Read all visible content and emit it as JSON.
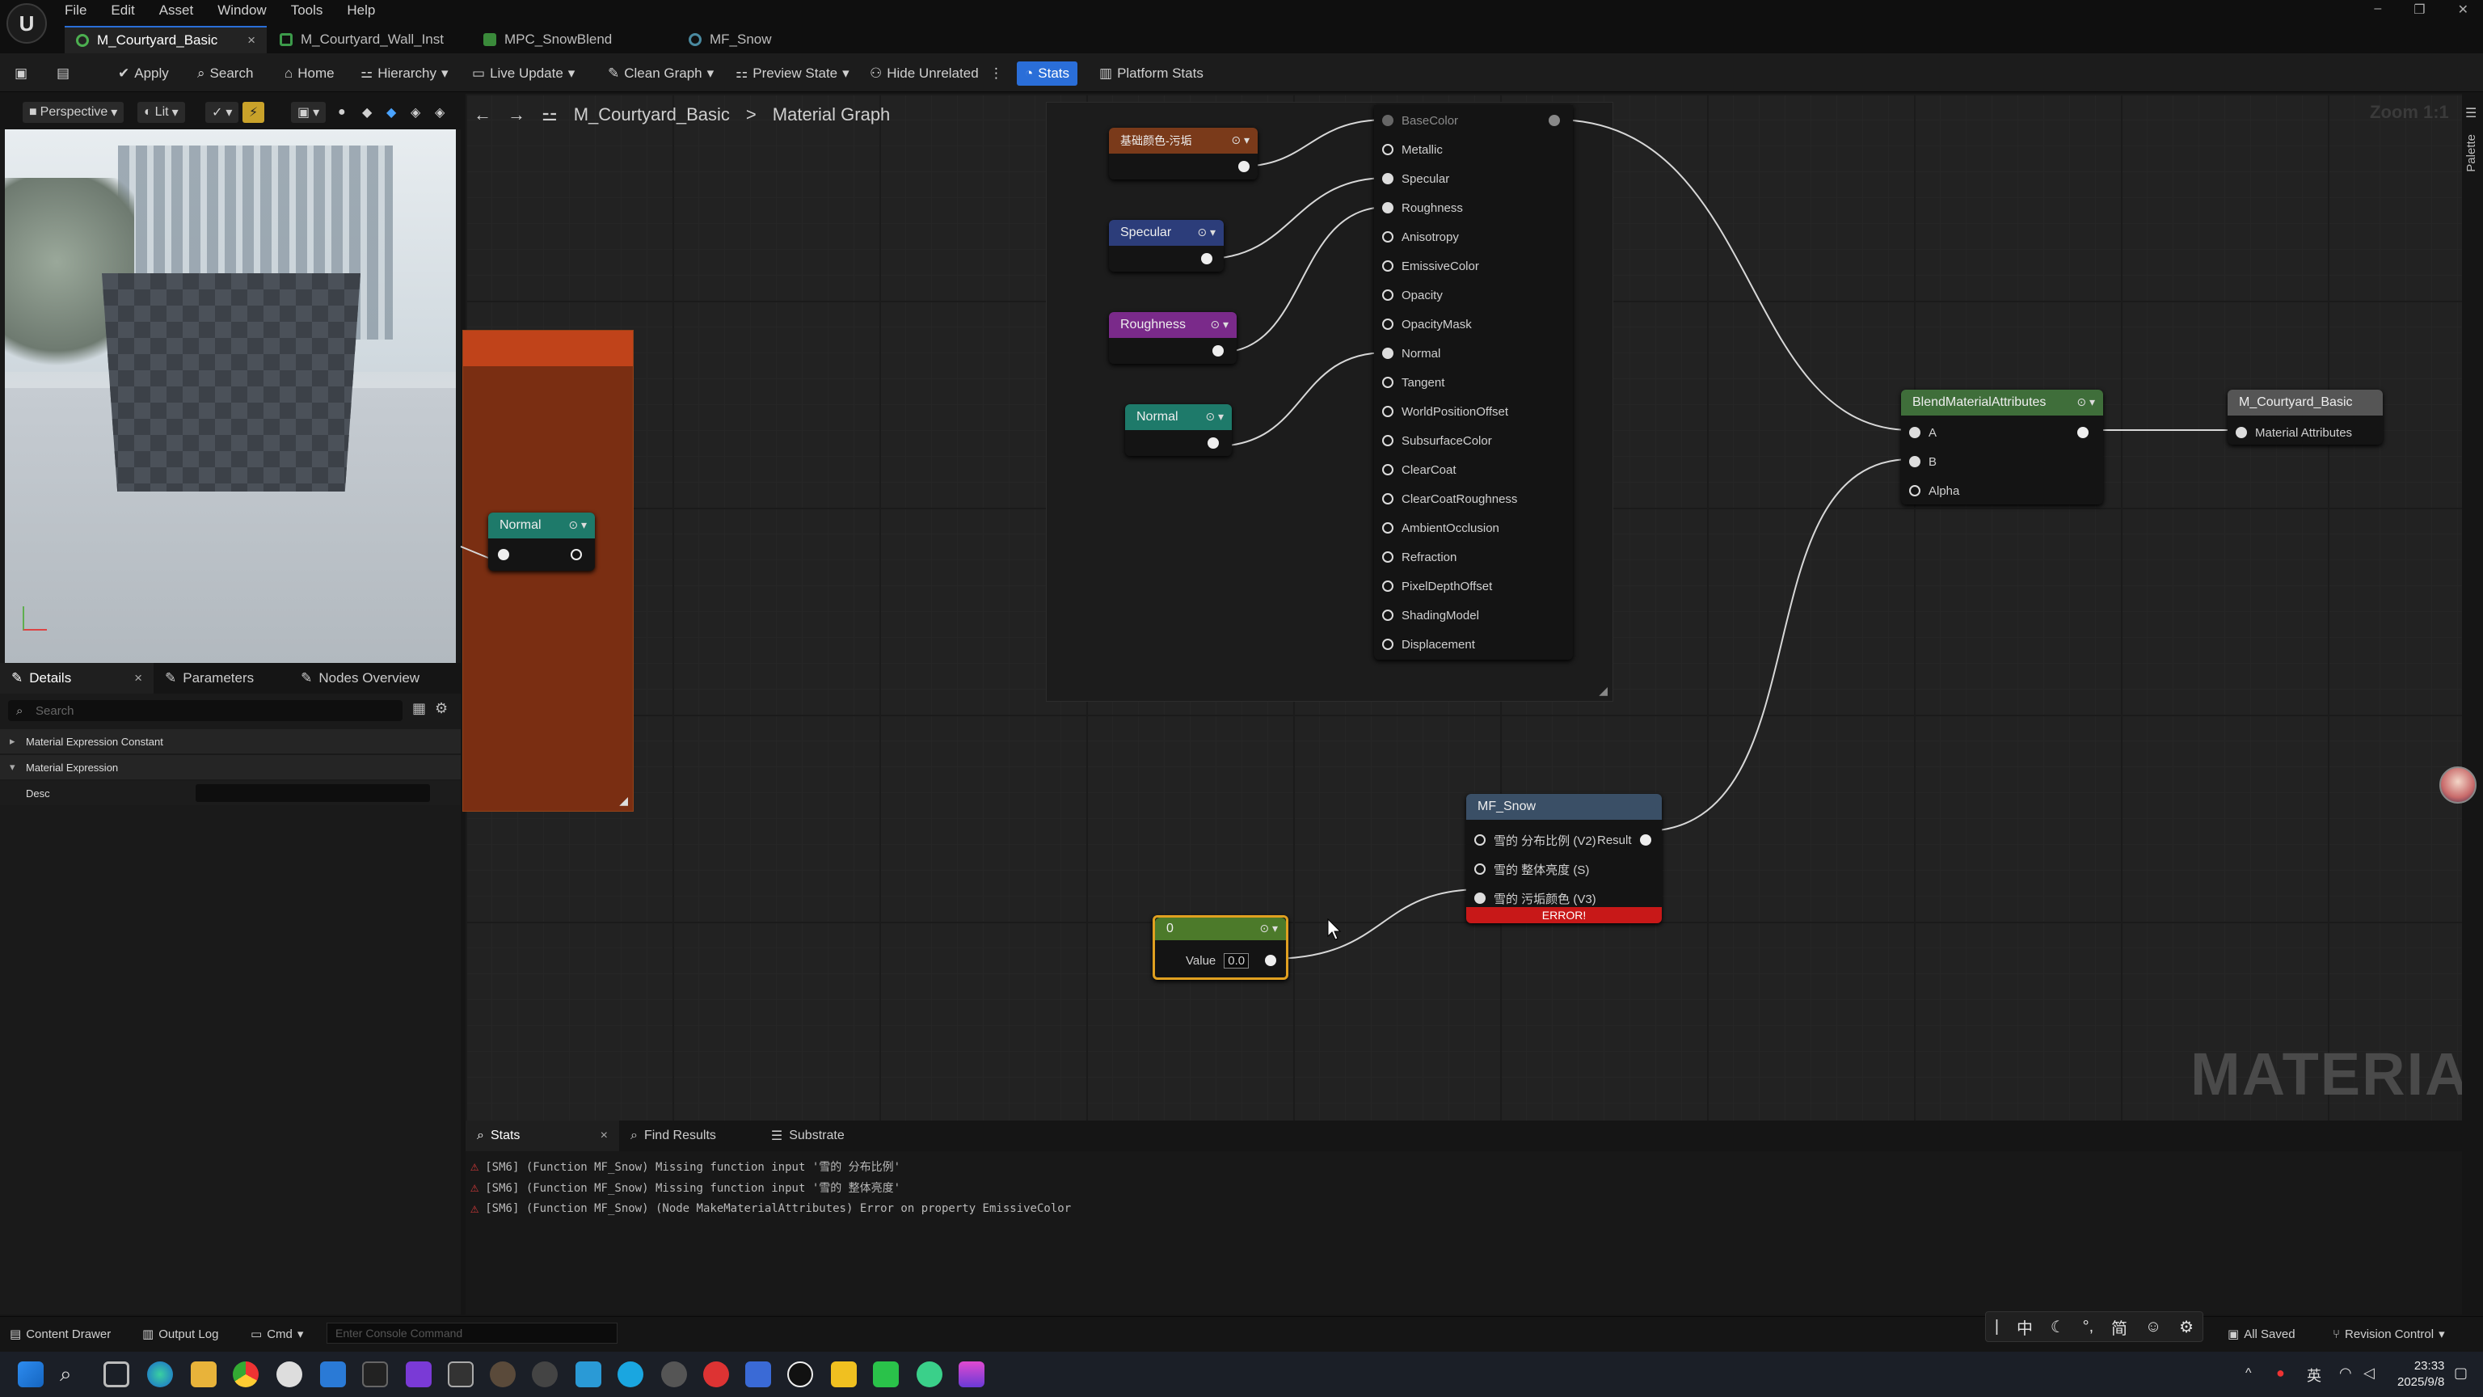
{
  "menu": [
    "File",
    "Edit",
    "Asset",
    "Window",
    "Tools",
    "Help"
  ],
  "tabs": [
    {
      "label": "M_Courtyard_Basic",
      "close": "×"
    },
    {
      "label": "M_Courtyard_Wall_Inst"
    },
    {
      "label": "MPC_SnowBlend"
    },
    {
      "label": "MF_Snow"
    }
  ],
  "toolbar": {
    "apply": "Apply",
    "search": "Search",
    "home": "Home",
    "hierarchy": "Hierarchy",
    "live_update": "Live Update",
    "clean_graph": "Clean Graph",
    "preview_state": "Preview State",
    "hide_unrelated": "Hide Unrelated",
    "stats": "Stats",
    "platform_stats": "Platform Stats"
  },
  "viewport": {
    "perspective": "Perspective",
    "lit": "Lit"
  },
  "panel_tabs": {
    "details": "Details",
    "parameters": "Parameters",
    "nodes_overview": "Nodes Overview"
  },
  "details": {
    "search_placeholder": "Search",
    "section1": "Material Expression Constant",
    "section2": "Material Expression",
    "desc_label": "Desc"
  },
  "graph": {
    "breadcrumb_root": "M_Courtyard_Basic",
    "breadcrumb_sep": ">",
    "breadcrumb_leaf": "Material Graph",
    "zoom": "Zoom 1:1",
    "watermark": "MATERIAL"
  },
  "nodes": {
    "basecolor_param": "基础颜色-污垢",
    "specular": "Specular",
    "roughness": "Roughness",
    "normal_top": "Normal",
    "normal_left": "Normal",
    "blend": {
      "title": "BlendMaterialAttributes",
      "a": "A",
      "b": "B",
      "alpha": "Alpha"
    },
    "output": {
      "title": "M_Courtyard_Basic",
      "pin": "Material Attributes"
    },
    "mf_snow": {
      "title": "MF_Snow",
      "in1": "雪的 分布比例 (V2)",
      "in2": "雪的 整体亮度 (S)",
      "in3": "雪的 污垢颜色 (V3)",
      "result": "Result",
      "error": "ERROR!"
    },
    "constant": {
      "title": "0",
      "value_label": "Value",
      "value": "0.0"
    },
    "make_attrs": [
      "BaseColor",
      "Metallic",
      "Specular",
      "Roughness",
      "Anisotropy",
      "EmissiveColor",
      "Opacity",
      "OpacityMask",
      "Normal",
      "Tangent",
      "WorldPositionOffset",
      "SubsurfaceColor",
      "ClearCoat",
      "ClearCoatRoughness",
      "AmbientOcclusion",
      "Refraction",
      "PixelDepthOffset",
      "ShadingModel",
      "Displacement"
    ]
  },
  "bottom_tabs": {
    "stats": "Stats",
    "find_results": "Find Results",
    "substrate": "Substrate"
  },
  "errors": [
    "[SM6] (Function MF_Snow) Missing function input '雪的 分布比例'",
    "[SM6] (Function MF_Snow) Missing function input '雪的 整体亮度'",
    "[SM6] (Function MF_Snow) (Node MakeMaterialAttributes) Error on property EmissiveColor"
  ],
  "statusbar": {
    "content_drawer": "Content Drawer",
    "output_log": "Output Log",
    "cmd": "Cmd",
    "console_placeholder": "Enter Console Command",
    "all_saved": "All Saved",
    "revision_control": "Revision Control"
  },
  "palette": "Palette",
  "ime": [
    "中",
    "简"
  ],
  "clock": {
    "time": "23:33",
    "date": "2025/9/8"
  },
  "colors": {
    "accent": "#2a6ed8",
    "error": "#c81818",
    "param_purple": "#7a2a8a",
    "param_teal": "#1e7a6a",
    "blend_green": "#3f6e3a"
  }
}
